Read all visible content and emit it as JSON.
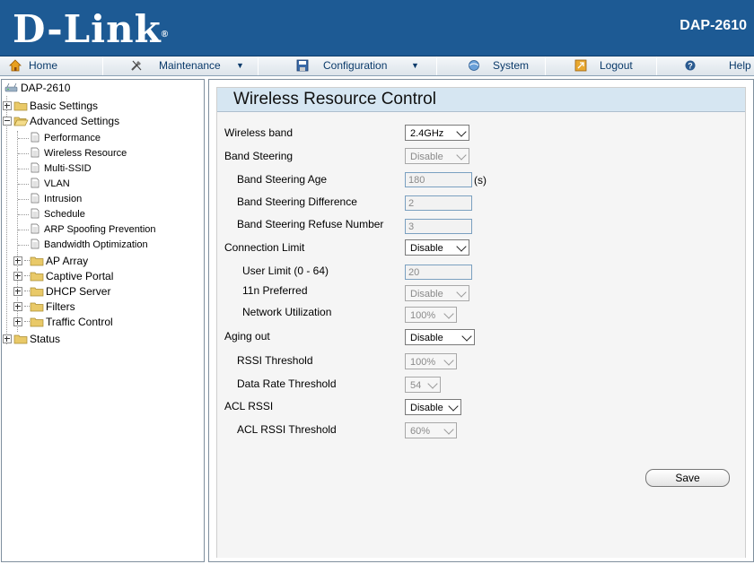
{
  "header": {
    "logo_text": "D-Link",
    "logo_mark": "®",
    "model": "DAP-2610"
  },
  "menu": {
    "items": [
      {
        "label": "Home",
        "icon": "home-icon"
      },
      {
        "label": "Maintenance",
        "icon": "tools-icon"
      },
      {
        "label": "Configuration",
        "icon": "save-disk-icon"
      },
      {
        "label": "System",
        "icon": "system-icon"
      },
      {
        "label": "Logout",
        "icon": "logout-icon"
      },
      {
        "label": "Help",
        "icon": "help-icon"
      }
    ]
  },
  "sidebar": {
    "root": "DAP-2610",
    "basic": "Basic Settings",
    "advanced": "Advanced Settings",
    "children": [
      "Performance",
      "Wireless Resource",
      "Multi-SSID",
      "VLAN",
      "Intrusion",
      "Schedule",
      "ARP Spoofing Prevention",
      "Bandwidth Optimization"
    ],
    "folders": [
      "AP Array",
      "Captive Portal",
      "DHCP Server",
      "Filters",
      "Traffic Control"
    ],
    "status": "Status"
  },
  "page": {
    "title": "Wireless Resource Control",
    "fields": {
      "wireless_band": {
        "label": "Wireless band",
        "value": "2.4GHz"
      },
      "band_steering": {
        "label": "Band Steering",
        "value": "Disable"
      },
      "band_steering_age": {
        "label": "Band Steering Age",
        "value": "180",
        "unit": "(s)"
      },
      "band_steering_difference": {
        "label": "Band Steering Difference",
        "value": "2"
      },
      "band_steering_refuse": {
        "label": "Band Steering Refuse Number",
        "value": "3"
      },
      "connection_limit": {
        "label": "Connection Limit",
        "value": "Disable"
      },
      "user_limit": {
        "label": "User Limit (0 - 64)",
        "value": "20"
      },
      "preferred_11n": {
        "label": "11n Preferred",
        "value": "Disable"
      },
      "network_utilization": {
        "label": "Network Utilization",
        "value": "100%"
      },
      "aging_out": {
        "label": "Aging out",
        "value": "Disable"
      },
      "rssi_threshold": {
        "label": "RSSI Threshold",
        "value": "100%"
      },
      "data_rate_threshold": {
        "label": "Data Rate Threshold",
        "value": "54"
      },
      "acl_rssi": {
        "label": "ACL RSSI",
        "value": "Disable"
      },
      "acl_rssi_threshold": {
        "label": "ACL RSSI Threshold",
        "value": "60%"
      }
    },
    "save_label": "Save"
  },
  "colors": {
    "header_bg": "#1d5a94",
    "title_bar": "#d6e6f2",
    "panel_bg": "#f5f5f5"
  }
}
